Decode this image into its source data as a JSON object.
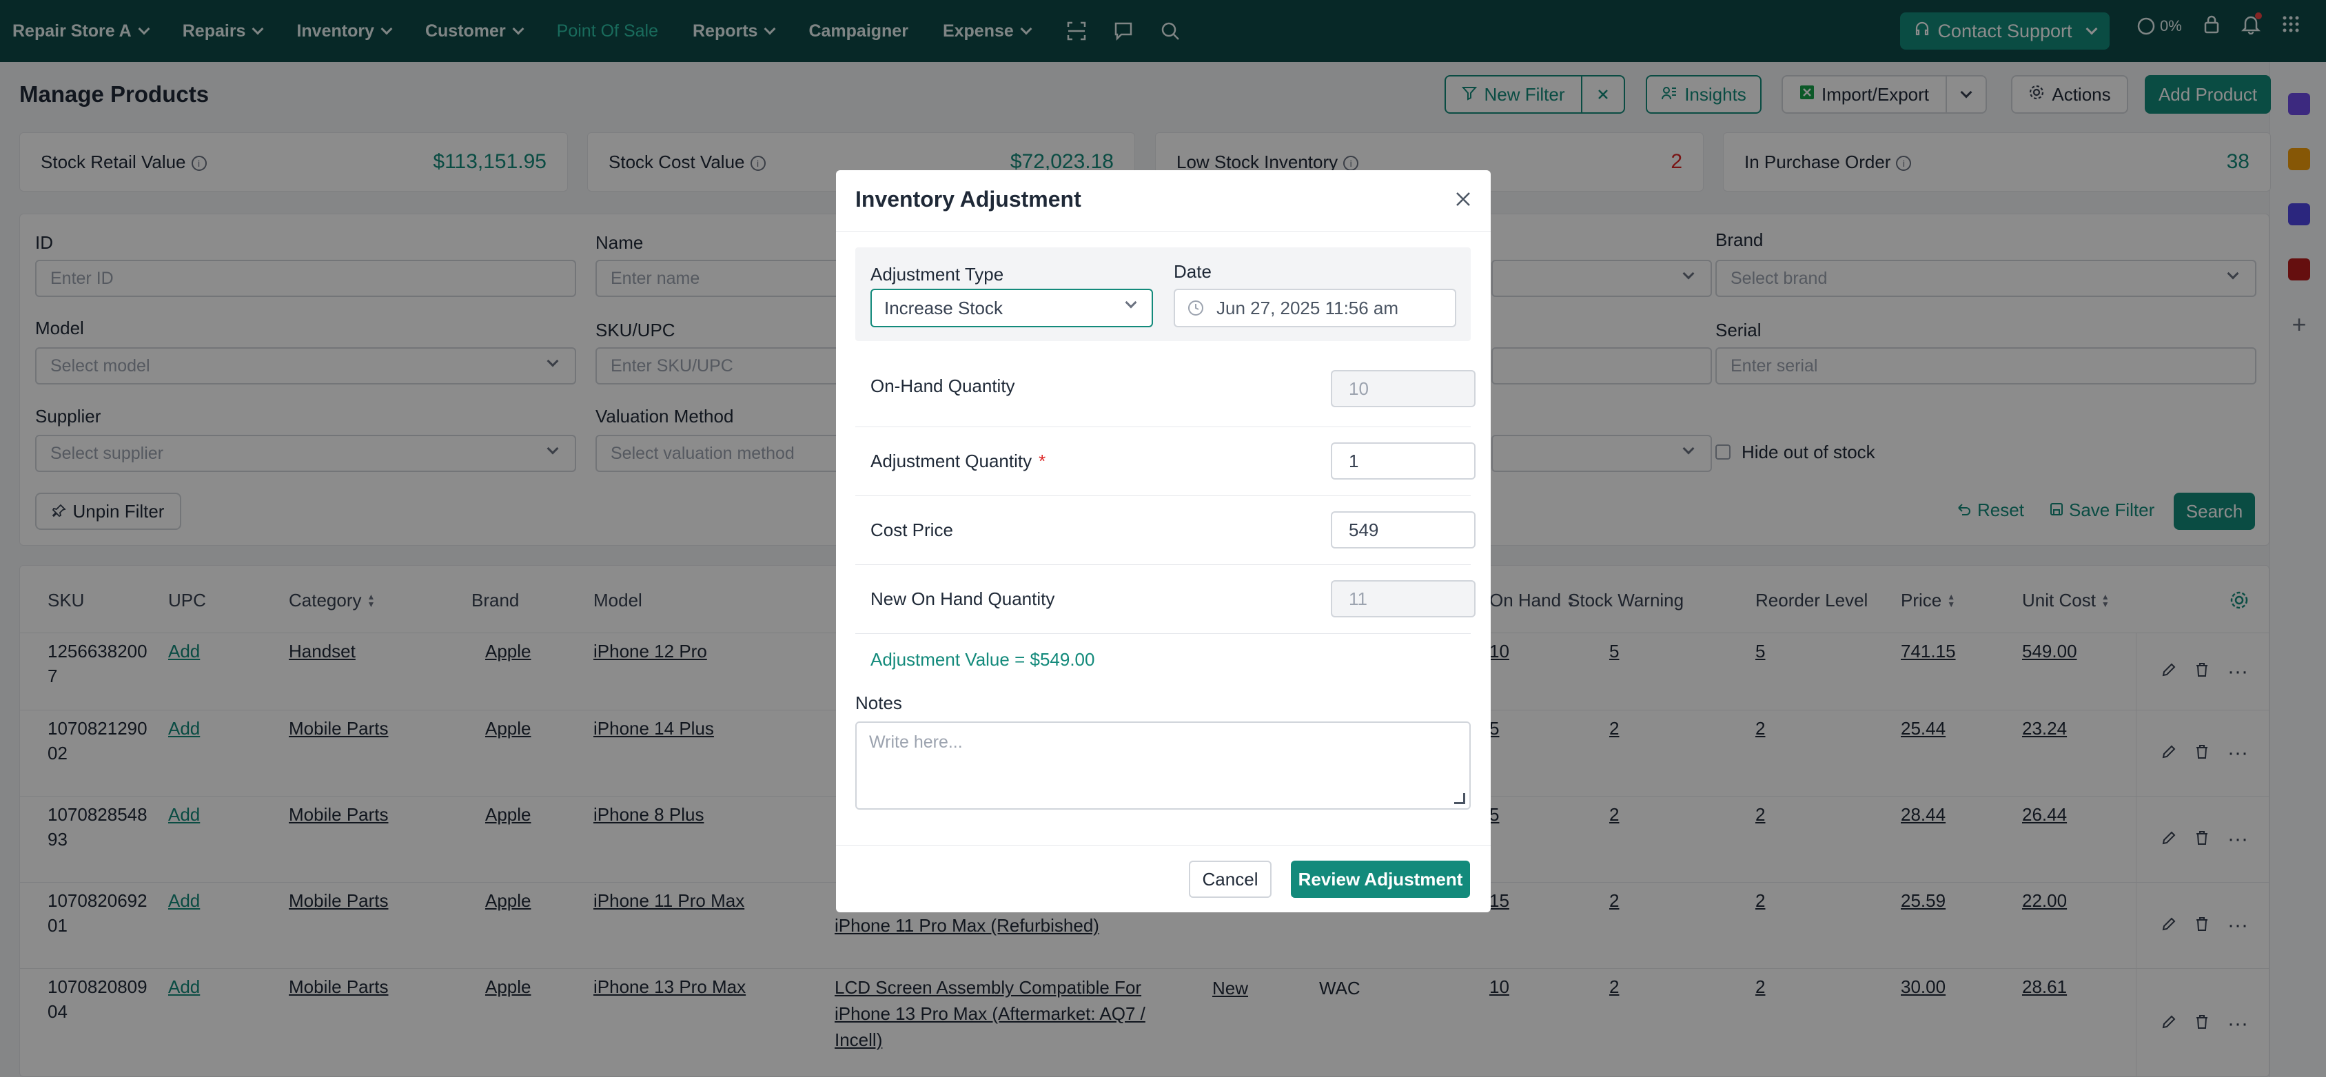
{
  "nav": {
    "store": "Repair Store A",
    "items": [
      "Repairs",
      "Inventory",
      "Customer",
      "Point Of Sale",
      "Reports",
      "Campaigner",
      "Expense"
    ],
    "support": "Contact Support",
    "progress": "0%"
  },
  "page": {
    "title": "Manage Products",
    "new_filter": "New Filter",
    "insights": "Insights",
    "import_export": "Import/Export",
    "actions": "Actions",
    "add_product": "Add Product"
  },
  "stats": [
    {
      "label": "Stock Retail Value",
      "value": "$113,151.95"
    },
    {
      "label": "Stock Cost Value",
      "value": "$72,023.18"
    },
    {
      "label": "Low Stock Inventory",
      "value": "2"
    },
    {
      "label": "In Purchase Order",
      "value": "38"
    }
  ],
  "filters": {
    "id": {
      "label": "ID",
      "placeholder": "Enter ID"
    },
    "name": {
      "label": "Name",
      "placeholder": "Enter name"
    },
    "brand": {
      "label": "Brand",
      "placeholder": "Select brand"
    },
    "model": {
      "label": "Model",
      "placeholder": "Select model"
    },
    "sku": {
      "label": "SKU/UPC",
      "placeholder": "Enter SKU/UPC"
    },
    "serial": {
      "label": "Serial",
      "placeholder": "Enter serial"
    },
    "supplier": {
      "label": "Supplier",
      "placeholder": "Select supplier"
    },
    "valuation": {
      "label": "Valuation Method",
      "placeholder": "Select valuation method"
    },
    "hide_oos": "Hide out of stock",
    "unpin": "Unpin Filter",
    "reset": "Reset",
    "save": "Save Filter",
    "search": "Search"
  },
  "table": {
    "headers": [
      "SKU",
      "UPC",
      "Category",
      "Brand",
      "Model",
      "On Hand",
      "Stock Warning",
      "Reorder Level",
      "Price",
      "Unit Cost"
    ],
    "rows": [
      {
        "sku1": "1256638200",
        "sku2": "7",
        "upc": "Add",
        "category": "Handset",
        "brand": "Apple",
        "model": "iPhone 12 Pro",
        "name1": "",
        "name2": "",
        "name3": "",
        "cond": "",
        "val": "",
        "on_hand": "10",
        "warn": "5",
        "reorder": "5",
        "price": "741.15",
        "cost": "549.00"
      },
      {
        "sku1": "1070821290",
        "sku2": "02",
        "upc": "Add",
        "category": "Mobile Parts",
        "brand": "Apple",
        "model": "iPhone 14 Plus",
        "name1": "",
        "name2": "",
        "name3": "",
        "cond": "",
        "val": "",
        "on_hand": "5",
        "warn": "2",
        "reorder": "2",
        "price": "25.44",
        "cost": "23.24"
      },
      {
        "sku1": "1070828548",
        "sku2": "93",
        "upc": "Add",
        "category": "Mobile Parts",
        "brand": "Apple",
        "model": "iPhone 8 Plus",
        "name1": "",
        "name2": "",
        "name3": "",
        "cond": "",
        "val": "",
        "on_hand": "5",
        "warn": "2",
        "reorder": "2",
        "price": "28.44",
        "cost": "26.44"
      },
      {
        "sku1": "1070820692",
        "sku2": "01",
        "upc": "Add",
        "category": "Mobile Parts",
        "brand": "Apple",
        "model": "iPhone 11 Pro Max",
        "name1": "iPhone 11 Pro Max (Refurbished)",
        "name2": "",
        "name3": "",
        "cond": "",
        "val": "",
        "on_hand": "15",
        "warn": "2",
        "reorder": "2",
        "price": "25.59",
        "cost": "22.00"
      },
      {
        "sku1": "1070820809",
        "sku2": "04",
        "upc": "Add",
        "category": "Mobile Parts",
        "brand": "Apple",
        "model": "iPhone 13 Pro Max",
        "name1": "LCD Screen Assembly Compatible For",
        "name2": "iPhone 13 Pro Max (Aftermarket: AQ7 /",
        "name3": "Incell)",
        "cond": "New",
        "val": "WAC",
        "on_hand": "10",
        "warn": "2",
        "reorder": "2",
        "price": "30.00",
        "cost": "28.61"
      }
    ]
  },
  "modal": {
    "title": "Inventory Adjustment",
    "type_label": "Adjustment Type",
    "type_value": "Increase Stock",
    "date_label": "Date",
    "date_value": "Jun 27, 2025 11:56 am",
    "on_hand_label": "On-Hand Quantity",
    "on_hand_value": "10",
    "adj_qty_label": "Adjustment Quantity",
    "adj_qty_value": "1",
    "cost_label": "Cost Price",
    "cost_value": "549",
    "new_on_hand_label": "New On Hand Quantity",
    "new_on_hand_value": "11",
    "adjustment_value": "Adjustment Value = $549.00",
    "notes_label": "Notes",
    "notes_placeholder": "Write here...",
    "cancel": "Cancel",
    "review": "Review Adjustment"
  }
}
